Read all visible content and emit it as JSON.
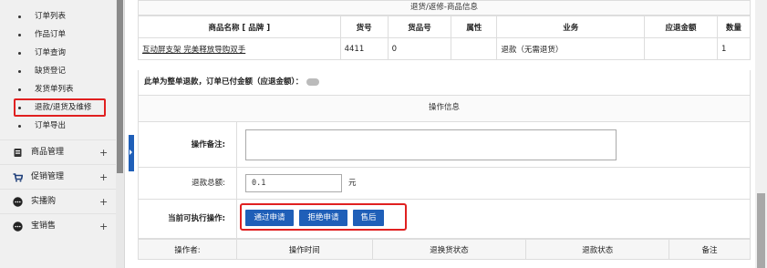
{
  "sidebar": {
    "sub_items": [
      {
        "label": "订单列表",
        "highlighted": false
      },
      {
        "label": "作品订单",
        "highlighted": false
      },
      {
        "label": "订单查询",
        "highlighted": false
      },
      {
        "label": "缺货登记",
        "highlighted": false
      },
      {
        "label": "发货单列表",
        "highlighted": false
      },
      {
        "label": "退款/退货及维修",
        "highlighted": true
      },
      {
        "label": "订单导出",
        "highlighted": false
      }
    ],
    "main_items": [
      {
        "label": "商品管理",
        "icon": "goods-icon",
        "expand": "+"
      },
      {
        "label": "促销管理",
        "icon": "cart-icon",
        "expand": "+"
      },
      {
        "label": "实播购",
        "icon": "chat-icon",
        "expand": "+"
      },
      {
        "label": "宝销售",
        "icon": "chat-icon",
        "expand": "+"
      }
    ]
  },
  "goods_section": {
    "title": "退货/返修-商品信息",
    "headers": [
      "商品名称 [ 品牌 ]",
      "货号",
      "货品号",
      "属性",
      "业务",
      "应退金额",
      "数量"
    ],
    "rows": [
      {
        "name": "互动屏支架 完美释放导购双手",
        "sn": "4411",
        "product_sn": "0",
        "attr": "",
        "business": "退款（无需退货）",
        "amount": "",
        "qty": "1"
      }
    ],
    "refund_note": "此单为整单退款，订单已付金额（应退金额）："
  },
  "operation_section": {
    "title": "操作信息",
    "note_label": "操作备注:",
    "note_value": "",
    "refund_total_label": "退款总额:",
    "refund_total_value": "0.1",
    "refund_unit": "元",
    "actions_label": "当前可执行操作:",
    "buttons": [
      "通过申请",
      "拒绝申请",
      "售后"
    ]
  },
  "log_table": {
    "headers": [
      "操作者:",
      "操作时间",
      "退换货状态",
      "退款状态",
      "备注"
    ]
  },
  "colors": {
    "accent": "#1f5fb8",
    "highlight": "#e02020"
  }
}
